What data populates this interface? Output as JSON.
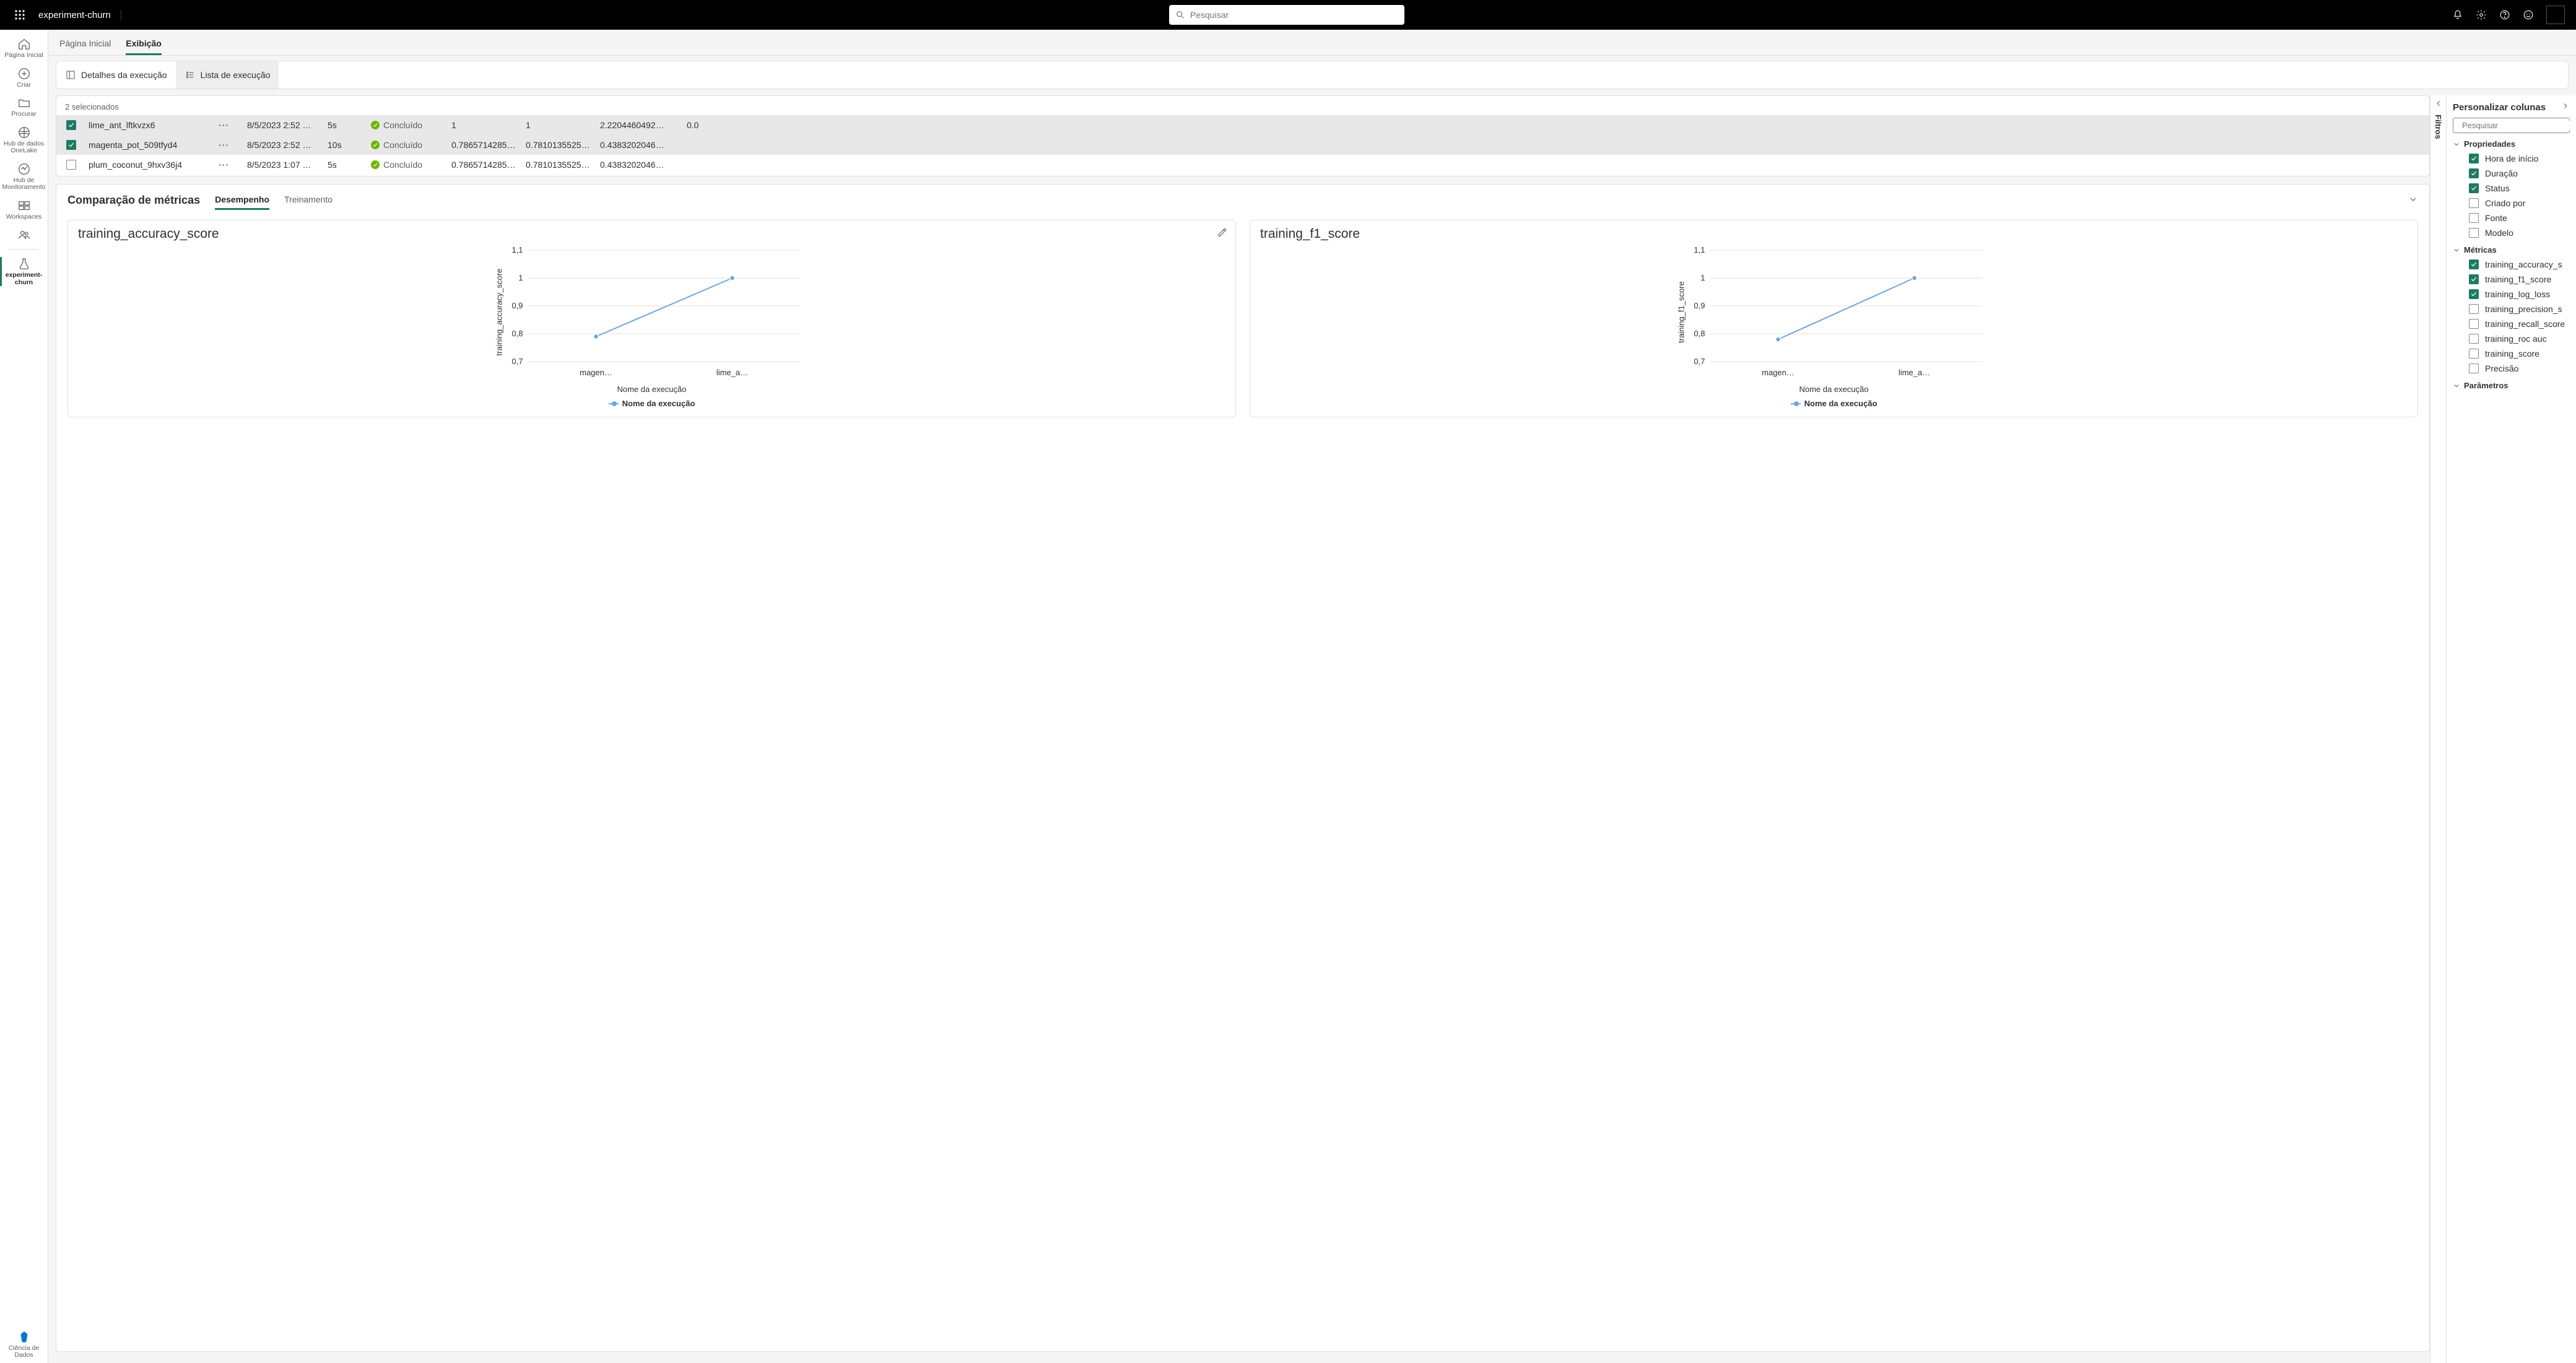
{
  "topbar": {
    "breadcrumb": "experiment-churn",
    "search_placeholder": "Pesquisar"
  },
  "leftrail": {
    "home": "Página Inicial",
    "create": "Criar",
    "browse": "Procurar",
    "onelake": "Hub de dados OneLake",
    "monitoring": "Hub de Monitoramento",
    "workspaces": "Workspaces",
    "experiment": "experiment-churn",
    "brand": "Ciência de Dados"
  },
  "page_tabs": {
    "home": "Página Inicial",
    "view": "Exibição"
  },
  "toolbar": {
    "details": "Detalhes da execução",
    "list": "Lista de execução"
  },
  "runs": {
    "selected_text": "2 selecionados",
    "rows": [
      {
        "selected": true,
        "name": "lime_ant_lftkvzx6",
        "time": "8/5/2023 2:52 …",
        "dur": "5s",
        "status": "Concluído",
        "v1": "1",
        "v2": "1",
        "v3": "2.2204460492…",
        "v4": "0.0"
      },
      {
        "selected": true,
        "name": "magenta_pot_509tfyd4",
        "time": "8/5/2023 2:52 …",
        "dur": "10s",
        "status": "Concluído",
        "v1": "0.7865714285…",
        "v2": "0.7810135525…",
        "v3": "0.4383202046…",
        "v4": ""
      },
      {
        "selected": false,
        "name": "plum_coconut_9hxv36j4",
        "time": "8/5/2023 1:07 …",
        "dur": "5s",
        "status": "Concluído",
        "v1": "0.7865714285…",
        "v2": "0.7810135525…",
        "v3": "0.4383202046…",
        "v4": ""
      }
    ]
  },
  "metrics": {
    "title": "Comparação de métricas",
    "tab_perf": "Desempenho",
    "tab_train": "Treinamento",
    "xlabel": "Nome da execução",
    "legend": "Nome da execução"
  },
  "filters_label": "Filtros",
  "right": {
    "title": "Personalizar colunas",
    "search_placeholder": "Pesquisar",
    "props": {
      "h": "Propriedades",
      "start": "Hora de início",
      "dur": "Duração",
      "status": "Status",
      "created": "Criado por",
      "source": "Fonte",
      "model": "Modelo"
    },
    "mets": {
      "h": "Métricas",
      "acc": "training_accuracy_s",
      "f1": "training_f1_score",
      "log": "training_log_loss",
      "prec": "training_precision_s",
      "rec": "training_recall_score",
      "roc": "training_roc auc",
      "score": "training_score",
      "precision": "Precisão"
    },
    "params_h": "Parâmetros"
  },
  "chart_data": [
    {
      "type": "line",
      "title": "training_accuracy_score",
      "xlabel": "Nome da execução",
      "ylabel": "training_accuracy_score",
      "categories": [
        "magen…",
        "lime_a…"
      ],
      "values": [
        0.79,
        1.0
      ],
      "ylim": [
        0.7,
        1.1
      ],
      "yticks": [
        0.7,
        0.8,
        0.9,
        1,
        1.1
      ]
    },
    {
      "type": "line",
      "title": "training_f1_score",
      "xlabel": "Nome da execução",
      "ylabel": "training_f1_score",
      "categories": [
        "magen…",
        "lime_a…"
      ],
      "values": [
        0.78,
        1.0
      ],
      "ylim": [
        0.7,
        1.1
      ],
      "yticks": [
        0.7,
        0.8,
        0.9,
        1,
        1.1
      ]
    }
  ]
}
